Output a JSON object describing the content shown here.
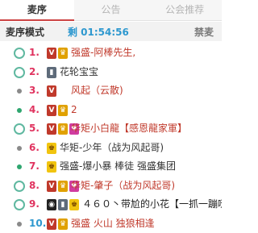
{
  "tabs": [
    "麦序",
    "公告",
    "公会推荐"
  ],
  "header": {
    "mode_label": "麦序模式",
    "timer": "剩 01:54:56",
    "mute_label": "禁麦"
  },
  "rows": [
    {
      "rank": "1.",
      "marker": "ring",
      "badges": [
        "v",
        "crown"
      ],
      "name": "强盛-阿棒先生,",
      "name_color": "red"
    },
    {
      "rank": "2.",
      "marker": "ring",
      "badges": [
        "phone"
      ],
      "name": "花轮宝宝",
      "name_color": "black"
    },
    {
      "rank": "3.",
      "marker": "small",
      "badges": [
        "v"
      ],
      "name": "风起（云散)",
      "name_color": "red"
    },
    {
      "rank": "4.",
      "marker": "dot",
      "badges": [
        "v",
        "crown"
      ],
      "name": "2",
      "name_color": "red"
    },
    {
      "rank": "5.",
      "marker": "ring",
      "badges": [
        "v",
        "crown",
        "gift"
      ],
      "name": "华矩小白龍【感恩龍家軍】",
      "name_color": "red"
    },
    {
      "rank": "6.",
      "marker": "small",
      "badges": [
        "gold"
      ],
      "name": "华矩-少年（战为风起哥)",
      "name_color": "black"
    },
    {
      "rank": "7.",
      "marker": "dot",
      "badges": [
        "gold"
      ],
      "name": "强盛-爆小暴 棒徒 强盛集团",
      "name_color": "black"
    },
    {
      "rank": "8.",
      "marker": "ring",
      "badges": [
        "v",
        "crown",
        "gift"
      ],
      "name": "华矩-肇子（战为风起哥)",
      "name_color": "red"
    },
    {
      "rank": "9.",
      "marker": "ring",
      "badges": [
        "glasses",
        "phone",
        "gold"
      ],
      "name": "４６０丶带尬的小花【一抓一蹦哒",
      "name_color": "dark"
    },
    {
      "rank": "10.",
      "marker": "small",
      "badges": [
        "v",
        "crown"
      ],
      "name": "强盛 火山 独狼相逢",
      "name_color": "red"
    }
  ]
}
